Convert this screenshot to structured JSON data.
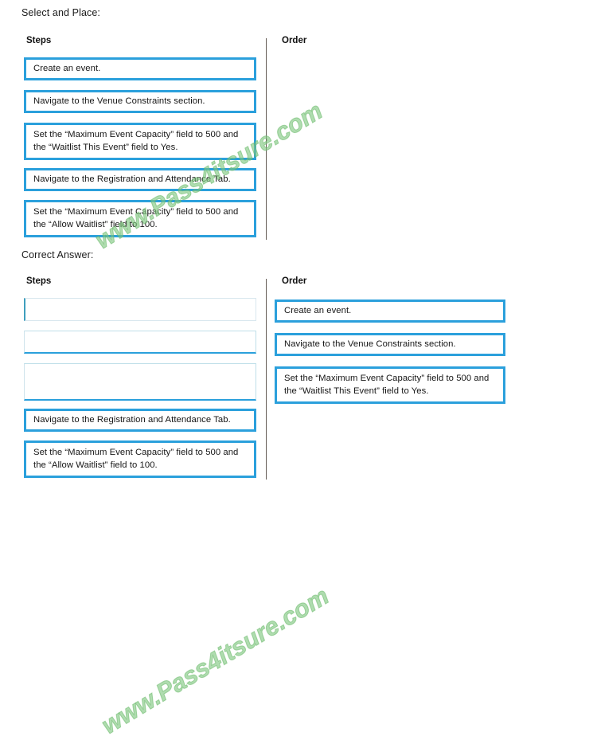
{
  "captions": {
    "select_and_place": "Select and Place:",
    "correct_answer": "Correct Answer:"
  },
  "columns": {
    "steps_header": "Steps",
    "order_header": "Order"
  },
  "watermark": {
    "text": "www.Pass4itsure.com",
    "color": "#7ec77e"
  },
  "colors": {
    "tile_border": "#2ba0dc",
    "tile_background": "#ffffff",
    "divider": "#4a4038",
    "text": "#161616"
  },
  "select_and_place": {
    "steps": [
      {
        "id": "step-create-event",
        "text": "Create an event.",
        "lines": 1
      },
      {
        "id": "step-venue-constraints",
        "text": "Navigate to the Venue Constraints section.",
        "lines": 1
      },
      {
        "id": "step-capacity-waitlist-yes",
        "text": "Set the “Maximum Event Capacity” field to 500 and the “Waitlist This Event”  field to Yes.",
        "lines": 2
      },
      {
        "id": "step-registration-attendance-tab",
        "text": "Navigate to the Registration and Attendance Tab.",
        "lines": 1
      },
      {
        "id": "step-capacity-allow-waitlist-100",
        "text": "Set the “Maximum Event Capacity” field to 500 and the “Allow Waitlist” field to 100.",
        "lines": 2
      }
    ],
    "order": []
  },
  "correct_answer": {
    "steps": [
      {
        "id": "slot-empty-1",
        "text": "",
        "lines": 1,
        "empty": true
      },
      {
        "id": "slot-empty-2",
        "text": "",
        "lines": 1,
        "empty": true
      },
      {
        "id": "slot-empty-3",
        "text": "",
        "lines": 2,
        "empty": true
      },
      {
        "id": "step-registration-attendance-tab",
        "text": "Navigate to the Registration and Attendance Tab.",
        "lines": 1
      },
      {
        "id": "step-capacity-allow-waitlist-100",
        "text": "Set the “Maximum Event Capacity” field to 500 and the “Allow Waitlist” field to 100.",
        "lines": 2
      }
    ],
    "order": [
      {
        "id": "order-1-create-event",
        "text": "Create an event.",
        "lines": 1
      },
      {
        "id": "order-2-venue-constraints",
        "text": "Navigate to the Venue Constraints section.",
        "lines": 1
      },
      {
        "id": "order-3-capacity-waitlist-yes",
        "text": "Set the “Maximum Event Capacity” field to 500 and the “Waitlist This Event”  field to Yes.",
        "lines": 2
      }
    ]
  }
}
